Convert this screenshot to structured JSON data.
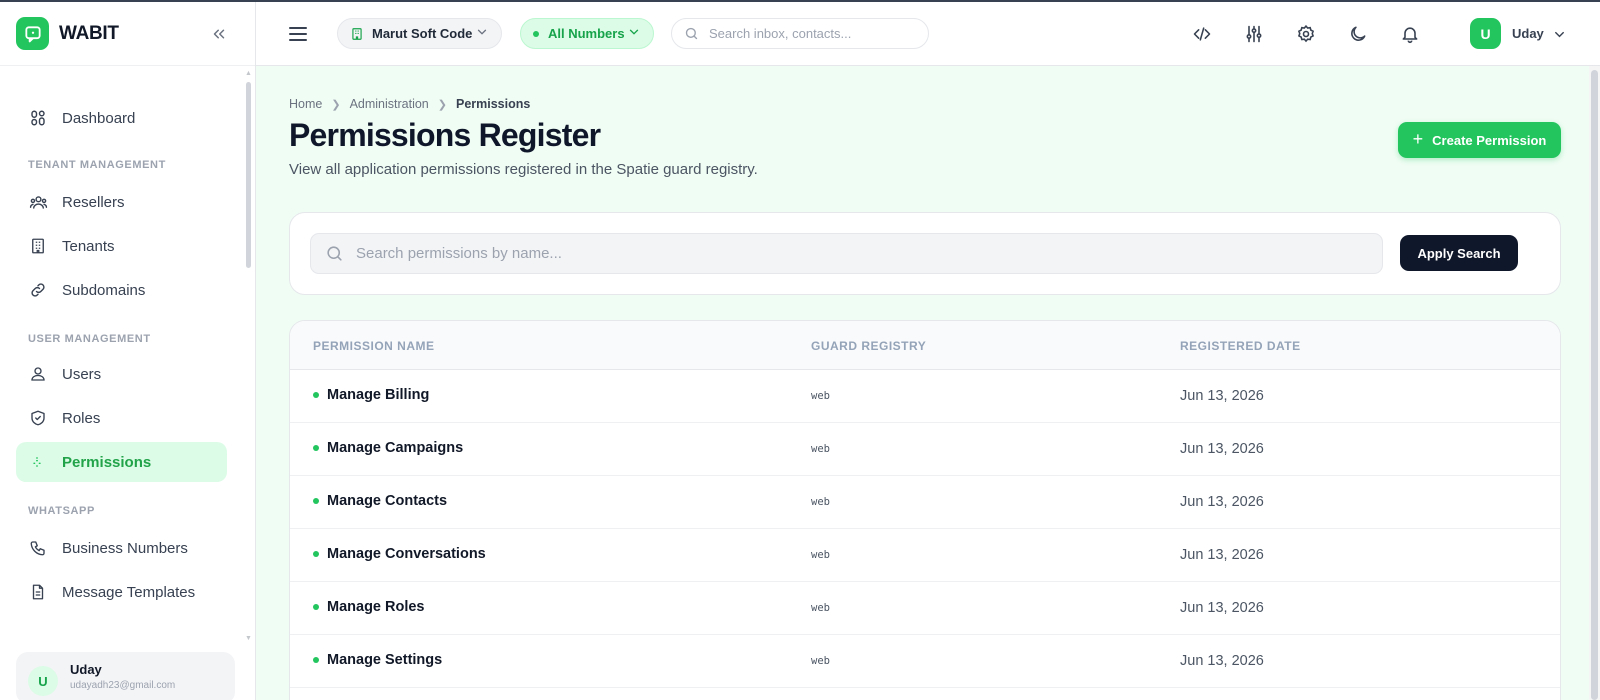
{
  "app": {
    "name": "WABIT"
  },
  "sidebar": {
    "items": [
      {
        "label": "Dashboard",
        "icon": "grid-icon"
      }
    ],
    "sections": [
      {
        "title": "TENANT MANAGEMENT",
        "items": [
          {
            "label": "Resellers",
            "icon": "users-icon"
          },
          {
            "label": "Tenants",
            "icon": "building-icon"
          },
          {
            "label": "Subdomains",
            "icon": "link-icon"
          }
        ]
      },
      {
        "title": "USER MANAGEMENT",
        "items": [
          {
            "label": "Users",
            "icon": "user-icon"
          },
          {
            "label": "Roles",
            "icon": "shield-icon"
          },
          {
            "label": "Permissions",
            "icon": "key-icon",
            "active": true
          }
        ]
      },
      {
        "title": "WHATSAPP",
        "items": [
          {
            "label": "Business Numbers",
            "icon": "phone-icon"
          },
          {
            "label": "Message Templates",
            "icon": "file-icon"
          }
        ]
      }
    ],
    "user": {
      "initial": "U",
      "name": "Uday",
      "email": "udayadh23@gmail.com"
    }
  },
  "topbar": {
    "org": "Marut Soft Code",
    "numbers_filter": "All Numbers",
    "search_placeholder": "Search inbox, contacts...",
    "user_initial": "U",
    "user_name": "Uday"
  },
  "page": {
    "breadcrumb": [
      "Home",
      "Administration",
      "Permissions"
    ],
    "title": "Permissions Register",
    "subtitle": "View all application permissions registered in the Spatie guard registry.",
    "create_button": "Create Permission",
    "search_placeholder": "Search permissions by name...",
    "apply_button": "Apply Search"
  },
  "table": {
    "columns": [
      "PERMISSION NAME",
      "GUARD REGISTRY",
      "REGISTERED DATE"
    ],
    "rows": [
      {
        "name": "Manage Billing",
        "guard": "web",
        "date": "Jun 13, 2026"
      },
      {
        "name": "Manage Campaigns",
        "guard": "web",
        "date": "Jun 13, 2026"
      },
      {
        "name": "Manage Contacts",
        "guard": "web",
        "date": "Jun 13, 2026"
      },
      {
        "name": "Manage Conversations",
        "guard": "web",
        "date": "Jun 13, 2026"
      },
      {
        "name": "Manage Roles",
        "guard": "web",
        "date": "Jun 13, 2026"
      },
      {
        "name": "Manage Settings",
        "guard": "web",
        "date": "Jun 13, 2026"
      }
    ]
  },
  "colors": {
    "accent": "#22c55e",
    "accent_light": "#dcfce7",
    "dark_button": "#0f172a",
    "page_bg": "#f0fdf4"
  }
}
